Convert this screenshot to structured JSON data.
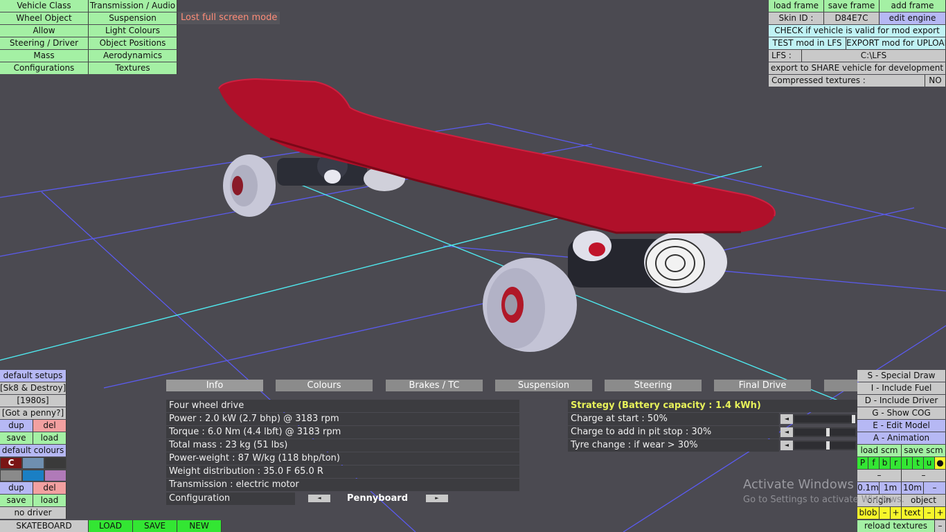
{
  "menu_left": [
    [
      "Vehicle Class",
      "Transmission / Audio"
    ],
    [
      "Wheel Object",
      "Suspension"
    ],
    [
      "Allow",
      "Light Colours"
    ],
    [
      "Steering / Driver",
      "Object Positions"
    ],
    [
      "Mass",
      "Aerodynamics"
    ],
    [
      "Configurations",
      "Textures"
    ]
  ],
  "notice": "Lost full screen mode",
  "top_right": {
    "load_frame": "load frame",
    "save_frame": "save frame",
    "add_frame": "add frame",
    "skin_id_label": "Skin ID :",
    "skin_id_value": "D84E7C",
    "edit_engine": "edit engine",
    "check_valid": "CHECK if vehicle is valid for mod export",
    "test_mod": "TEST mod in LFS",
    "export_mod": "EXPORT mod for UPLOAD",
    "lfs_label": "LFS :",
    "lfs_value": "C:\\LFS",
    "export_share": "export to SHARE vehicle for development",
    "compressed_label": "Compressed textures :",
    "compressed_value": "NO"
  },
  "tabs": [
    "Info",
    "Colours",
    "Brakes / TC",
    "Suspension",
    "Steering",
    "Final Drive",
    ""
  ],
  "info": {
    "lines": [
      "Four wheel drive",
      "Power : 2.0 kW (2.7 bhp) @ 3183 rpm",
      "Torque : 6.0 Nm (4.4 lbft) @ 3183 rpm",
      "Total mass : 23 kg (51 lbs)",
      "Power-weight : 87 W/kg (118 bhp/ton)",
      "Weight distribution : 35.0 F  65.0 R",
      "Transmission : electric motor"
    ],
    "config_label": "Configuration",
    "config_value": "Pennyboard",
    "config_prev": "◄",
    "config_next": "►"
  },
  "strategy": {
    "title": "Strategy (Battery capacity : 1.4 kWh)",
    "title_color": "#e8f25a",
    "rows": [
      {
        "label": "Charge at start : 50%",
        "arrow": "◄",
        "level": 1.0
      },
      {
        "label": "Charge to add in pit stop : 30%",
        "arrow": "◄",
        "level": 0.55
      },
      {
        "label": "Tyre change : if wear > 30%",
        "arrow": "◄",
        "level": 0.55
      }
    ]
  },
  "left_panel": {
    "default_setups": "default setups",
    "setup_1": "[Sk8 & Destroy]",
    "setup_2": "[1980s]",
    "setup_3": "[Got a penny?]",
    "dup": "dup",
    "del": "del",
    "save": "save",
    "load": "load",
    "default_colours": "default colours",
    "colour_c": "C",
    "dup2": "dup",
    "del2": "del",
    "save2": "save",
    "load2": "load",
    "no_driver": "no driver",
    "swatch_colors": [
      "#7a1515",
      "#6f8fb0",
      "#3a3a3a",
      "#8a8a8a",
      "#1a7fc4",
      "#b07ab8"
    ]
  },
  "bottom_bar": {
    "vehicle": "SKATEBOARD",
    "load": "LOAD",
    "save": "SAVE",
    "new": "NEW"
  },
  "right_panel": {
    "special_draw": "S - Special Draw",
    "include_fuel": "I - Include Fuel",
    "include_driver": "D - Include Driver",
    "show_cog": "G - Show COG",
    "edit_model": "E - Edit Model",
    "animation": "A - Animation",
    "load_scm": "load scm",
    "save_scm": "save scm",
    "letters": [
      "P",
      "f",
      "b",
      "r",
      "l",
      "t",
      "u",
      "●"
    ],
    "minus1": "–",
    "minus2": "–",
    "step_01": "0.1m",
    "step_1": "1m",
    "step_10": "10m",
    "step_minus": "–",
    "origin": "origin",
    "object": "object",
    "blob": "blob",
    "blob_minus": "–",
    "blob_plus": "+",
    "text": "text",
    "text_minus": "–",
    "text_plus": "+",
    "reload_textures": "reload textures",
    "reload_minus": "–"
  },
  "watermark": {
    "line1": "Activate Windows",
    "line2": "Go to Settings to activate Windows."
  }
}
